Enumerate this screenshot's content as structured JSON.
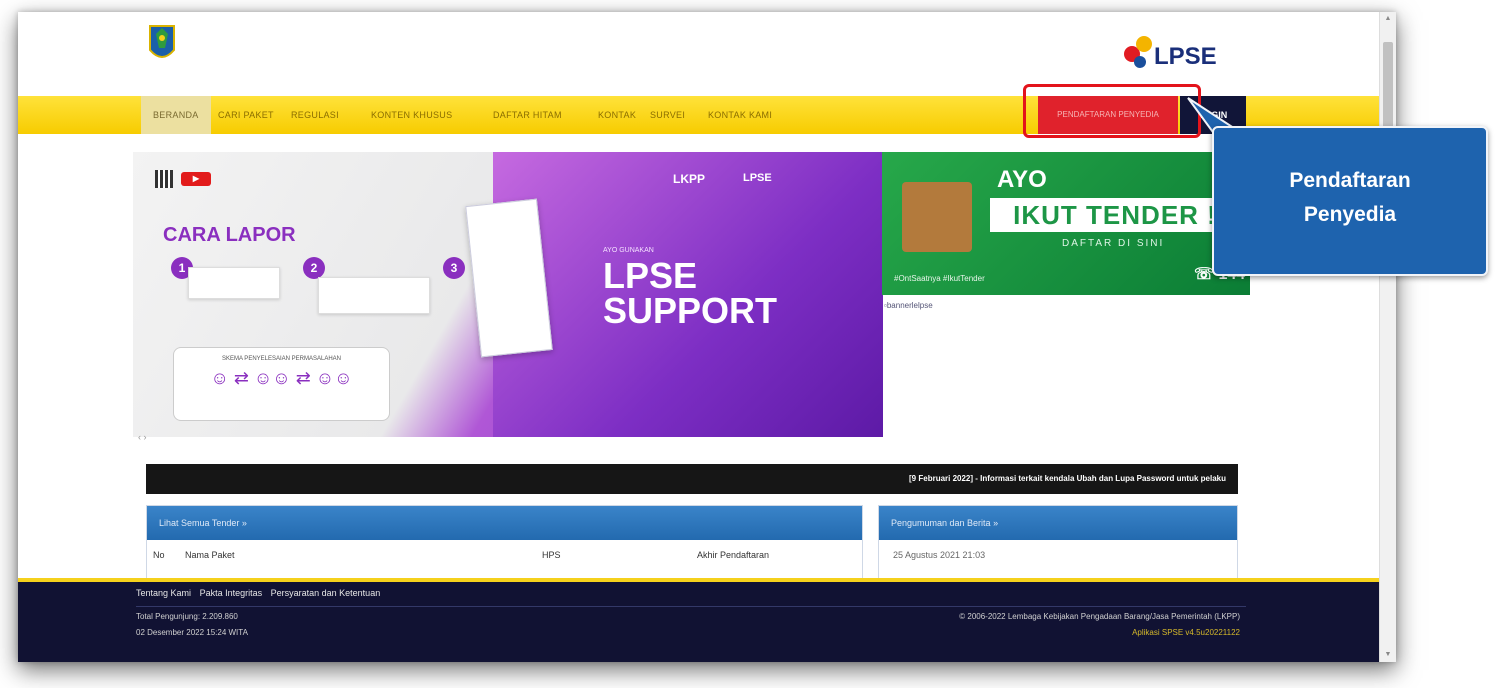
{
  "nav": {
    "items": [
      "BERANDA",
      "CARI PAKET",
      "REGULASI",
      "KONTEN KHUSUS",
      "DAFTAR HITAM",
      "KONTAK",
      "SURVEI",
      "KONTAK KAMI"
    ],
    "register_label": "PENDAFTARAN PENYEDIA",
    "login_label": "LOGIN"
  },
  "callout": {
    "line1": "Pendaftaran",
    "line2": "Penyedia"
  },
  "banner_left": {
    "cara_lapor": "CARA LAPOR",
    "ayo_gunakan": "AYO GUNAKAN",
    "lpse": "LPSE",
    "support": "SUPPORT",
    "lkpp": "LKPP",
    "lpse_logo": "LPSE",
    "skema": "SKEMA PENYELESAIAN PERMASALAHAN"
  },
  "banner_right": {
    "ayo": "AYO",
    "ikut_tender": "IKUT TENDER !",
    "daftar_di_sini": "DAFTAR DI SINI",
    "hashtag": "#OntSaatnya #IkutTender",
    "number": "144",
    "alt_text": "bannerlelpse"
  },
  "ticker": "[9 Februari 2022] - Informasi terkait kendala Ubah dan Lupa Password untuk pelaku",
  "tender_panel": {
    "title": "Lihat Semua Tender »",
    "columns": [
      "No",
      "Nama Paket",
      "HPS",
      "Akhir Pendaftaran"
    ]
  },
  "news_panel": {
    "title": "Pengumuman dan Berita »",
    "date": "25 Agustus 2021 21:03"
  },
  "footer": {
    "links": [
      "Tentang Kami",
      "Pakta Integritas",
      "Persyaratan dan Ketentuan"
    ],
    "visitors": "Total Pengunjung: 2.209.860",
    "datetime": "02 Desember 2022 15:24 WITA",
    "copyright": "© 2006-2022 Lembaga Kebijakan Pengadaan Barang/Jasa Pemerintah (LKPP)",
    "version": "Aplikasi SPSE v4.5u20221122"
  },
  "colors": {
    "nav_bg": "#f7cc00",
    "register_bg": "#e0222c",
    "login_bg": "#111538",
    "callout_bg": "#1e63ae",
    "footer_bg": "#111233"
  }
}
